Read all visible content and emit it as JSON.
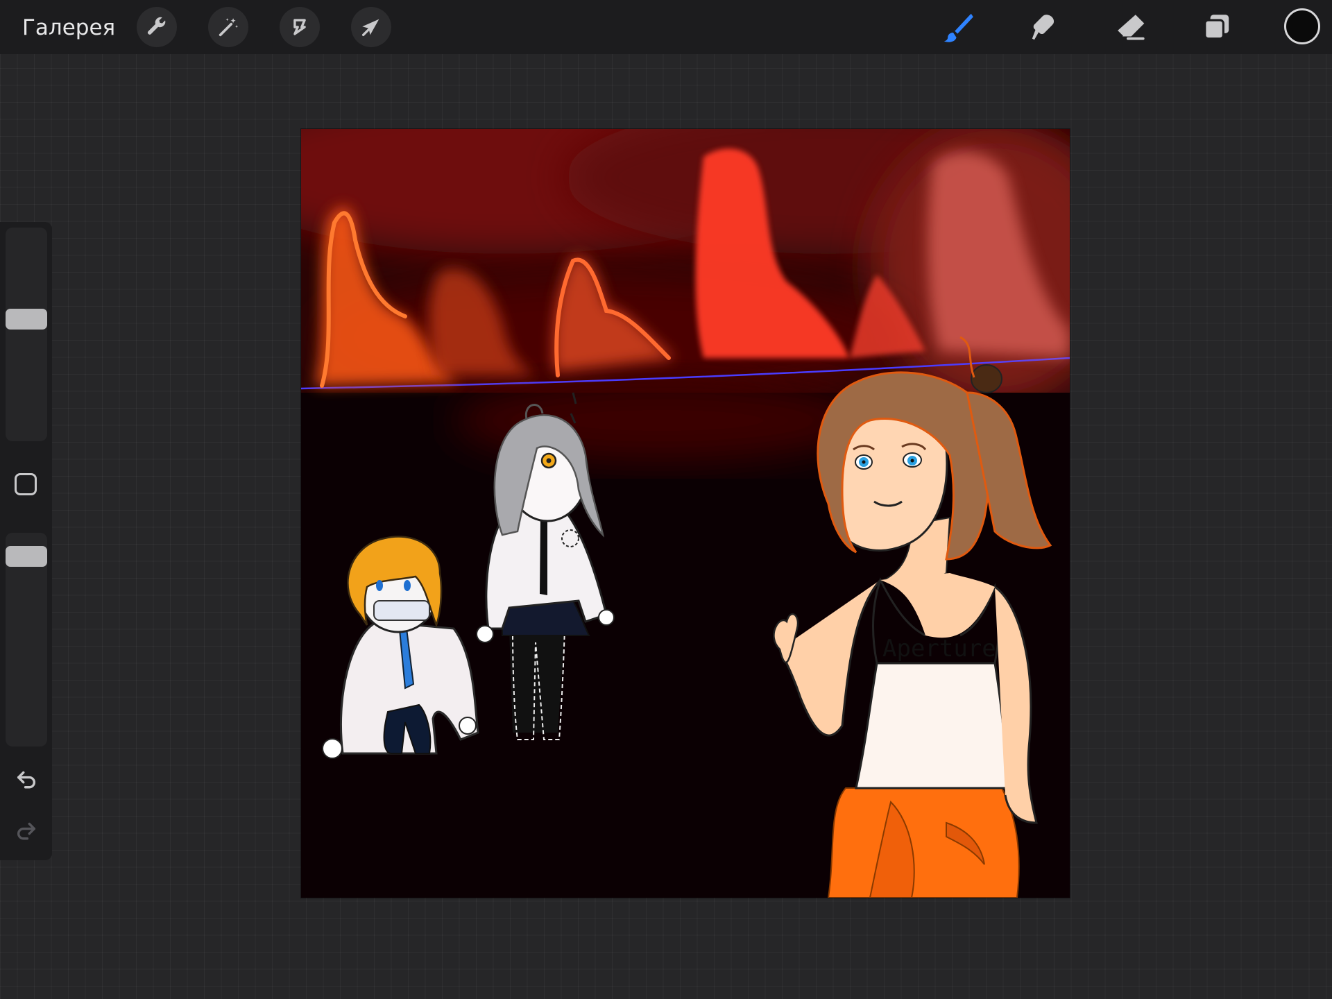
{
  "topbar": {
    "gallery_label": "Галерея",
    "left_tools": [
      {
        "name": "wrench-icon",
        "action": "actions"
      },
      {
        "name": "magic-wand-icon",
        "action": "adjustments"
      },
      {
        "name": "selection-icon",
        "action": "selection"
      },
      {
        "name": "arrow-cursor-icon",
        "action": "transform"
      }
    ],
    "right_tools": [
      {
        "name": "brush-icon",
        "active": true
      },
      {
        "name": "smudge-icon",
        "active": false
      },
      {
        "name": "eraser-icon",
        "active": false
      },
      {
        "name": "layers-icon",
        "active": false
      }
    ],
    "current_color": "#0a0a0a"
  },
  "sidebar": {
    "brush_size_level": 0.42,
    "opacity_level": 0.07
  },
  "canvas": {
    "background_color": "#0b0003",
    "shirt_text": "Aperture"
  },
  "colors": {
    "accent_blue": "#2f83ff",
    "icon_gray": "#c9c9cb"
  }
}
